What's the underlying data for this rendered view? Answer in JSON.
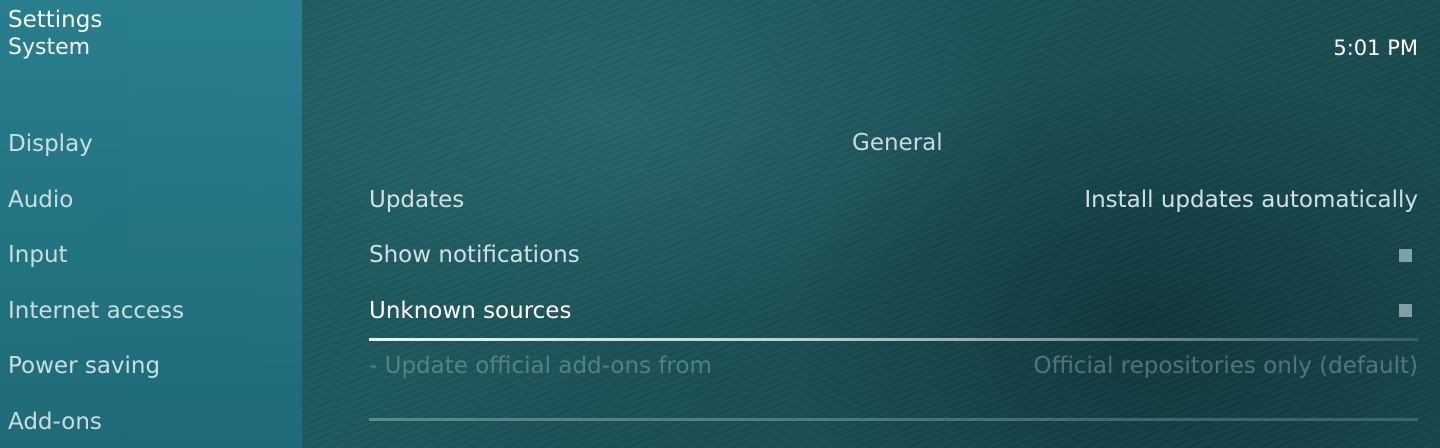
{
  "header": {
    "title": "Settings",
    "subtitle": "System"
  },
  "clock": "5:01 PM",
  "sidebar": {
    "items": [
      {
        "label": "Display"
      },
      {
        "label": "Audio"
      },
      {
        "label": "Input"
      },
      {
        "label": "Internet access"
      },
      {
        "label": "Power saving"
      },
      {
        "label": "Add-ons"
      }
    ],
    "selected": "Add-ons"
  },
  "main": {
    "section_label": "General",
    "settings": [
      {
        "label": "Updates",
        "value": "Install updates automatically"
      },
      {
        "label": "Show notifications",
        "value": "",
        "control": "checkbox"
      },
      {
        "label": "Unknown sources",
        "value": "",
        "control": "checkbox"
      },
      {
        "label": "- Update official add-ons from",
        "value": "Official repositories only (default)"
      }
    ],
    "focused": "Unknown sources"
  },
  "colors": {
    "sidebar": "#247684",
    "background": "#1f5a5f",
    "text": "#cfe0e2",
    "disabled_text": "#5f8c90"
  }
}
